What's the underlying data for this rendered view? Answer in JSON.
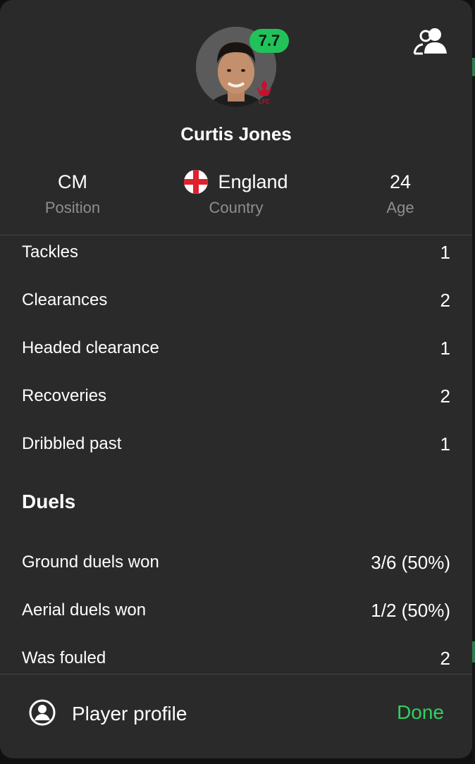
{
  "player": {
    "name": "Curtis Jones",
    "rating": "7.7",
    "rating_color": "#22c25a",
    "club_crest_icon": "liverpool-crest-icon",
    "club_crest_text": "LFC"
  },
  "header": {
    "compare_icon": "compare-players-icon"
  },
  "info": {
    "position": {
      "value": "CM",
      "label": "Position"
    },
    "country": {
      "value": "England",
      "label": "Country",
      "flag_icon": "england-flag-icon"
    },
    "age": {
      "value": "24",
      "label": "Age"
    }
  },
  "stats": {
    "rows": [
      {
        "label": "Tackles",
        "value": "1"
      },
      {
        "label": "Clearances",
        "value": "2"
      },
      {
        "label": "Headed clearance",
        "value": "1"
      },
      {
        "label": "Recoveries",
        "value": "2"
      },
      {
        "label": "Dribbled past",
        "value": "1"
      }
    ],
    "duels": {
      "title": "Duels",
      "rows": [
        {
          "label": "Ground duels won",
          "value": "3/6 (50%)"
        },
        {
          "label": "Aerial duels won",
          "value": "1/2 (50%)"
        },
        {
          "label": "Was fouled",
          "value": "2"
        }
      ]
    }
  },
  "footer": {
    "profile_label": "Player profile",
    "profile_icon": "user-circle-icon",
    "done_label": "Done",
    "accent_color": "#2fd15f"
  }
}
